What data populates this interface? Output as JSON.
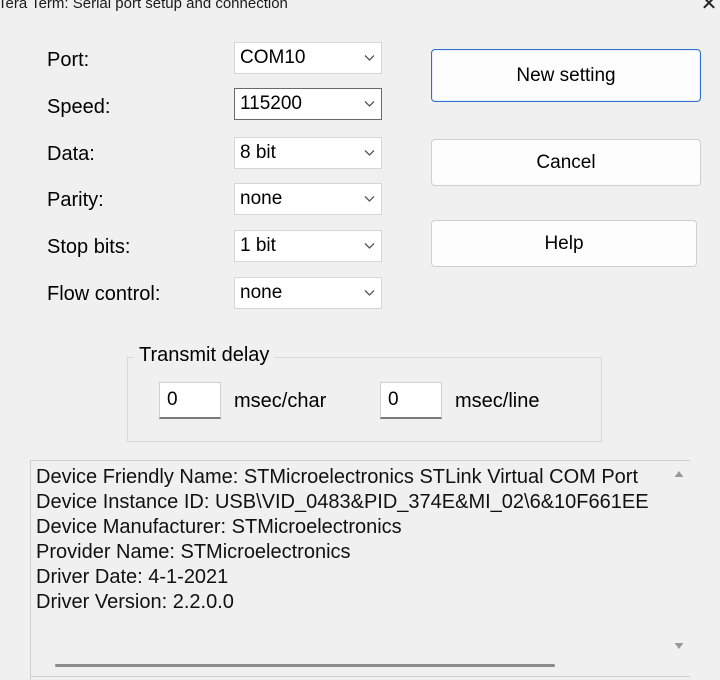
{
  "window": {
    "title": "Tera Term: Serial port setup and connection",
    "close_glyph": "✕"
  },
  "fields": [
    {
      "label": "Port:",
      "value": "COM10"
    },
    {
      "label": "Speed:",
      "value": "115200"
    },
    {
      "label": "Data:",
      "value": "8 bit"
    },
    {
      "label": "Parity:",
      "value": "none"
    },
    {
      "label": "Stop bits:",
      "value": "1 bit"
    },
    {
      "label": "Flow control:",
      "value": "none"
    }
  ],
  "buttons": {
    "new_setting": "New setting",
    "cancel": "Cancel",
    "help": "Help"
  },
  "transmit_delay": {
    "title": "Transmit delay",
    "char_value": "0",
    "char_unit": "msec/char",
    "line_value": "0",
    "line_unit": "msec/line"
  },
  "device_info": [
    "Device Friendly Name: STMicroelectronics STLink Virtual COM Port",
    "Device Instance ID: USB\\VID_0483&PID_374E&MI_02\\6&10F661EE",
    "Device Manufacturer: STMicroelectronics",
    "Provider Name: STMicroelectronics",
    "Driver Date: 4-1-2021",
    "Driver Version: 2.2.0.0"
  ],
  "icons": {
    "dropdown": "chevron-down-icon",
    "scroll_up": "scroll-up-arrow-icon",
    "scroll_down": "scroll-down-arrow-icon"
  },
  "colors": {
    "default_button_border": "#2f6fcf",
    "dialog_background": "#f0f0f0"
  }
}
